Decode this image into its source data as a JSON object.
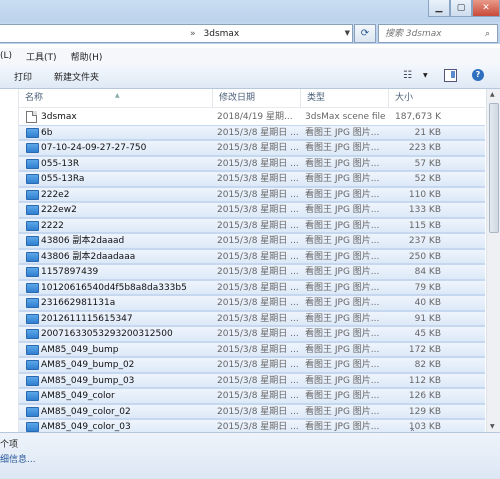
{
  "address": {
    "separator": "»",
    "path": "3dsmax",
    "search_placeholder": "搜索 3dsmax"
  },
  "menu": [
    "(L)",
    "工具(T)",
    "帮助(H)"
  ],
  "toolbar": {
    "print_label": "打印",
    "new_folder_label": "新建文件夹"
  },
  "columns": {
    "name": "名称",
    "date": "修改日期",
    "type": "类型",
    "size": "大小"
  },
  "files": [
    {
      "name": "3dsmax",
      "date": "2018/4/19 星期...",
      "type": "3dsMax scene file",
      "size": "187,673 KB",
      "icon": "max",
      "selected": false
    },
    {
      "name": "6b",
      "date": "2015/3/8 星期日 ...",
      "type": "看图王 JPG 图片...",
      "size": "21 KB",
      "icon": "jpg",
      "selected": true
    },
    {
      "name": "07-10-24-09-27-27-750",
      "date": "2015/3/8 星期日 ...",
      "type": "看图王 JPG 图片...",
      "size": "223 KB",
      "icon": "jpg",
      "selected": true
    },
    {
      "name": "055-13R",
      "date": "2015/3/8 星期日 ...",
      "type": "看图王 JPG 图片...",
      "size": "57 KB",
      "icon": "jpg",
      "selected": true
    },
    {
      "name": "055-13Ra",
      "date": "2015/3/8 星期日 ...",
      "type": "看图王 JPG 图片...",
      "size": "52 KB",
      "icon": "jpg",
      "selected": true
    },
    {
      "name": "222e2",
      "date": "2015/3/8 星期日 ...",
      "type": "看图王 JPG 图片...",
      "size": "110 KB",
      "icon": "jpg",
      "selected": true
    },
    {
      "name": "222ew2",
      "date": "2015/3/8 星期日 ...",
      "type": "看图王 JPG 图片...",
      "size": "133 KB",
      "icon": "jpg",
      "selected": true
    },
    {
      "name": "2222",
      "date": "2015/3/8 星期日 ...",
      "type": "看图王 JPG 图片...",
      "size": "115 KB",
      "icon": "jpg",
      "selected": true
    },
    {
      "name": "43806 副本2daaad",
      "date": "2015/3/8 星期日 ...",
      "type": "看图王 JPG 图片...",
      "size": "237 KB",
      "icon": "jpg",
      "selected": true
    },
    {
      "name": "43806 副本2daadaaa",
      "date": "2015/3/8 星期日 ...",
      "type": "看图王 JPG 图片...",
      "size": "250 KB",
      "icon": "jpg",
      "selected": true
    },
    {
      "name": "1157897439",
      "date": "2015/3/8 星期日 ...",
      "type": "看图王 JPG 图片...",
      "size": "84 KB",
      "icon": "jpg",
      "selected": true
    },
    {
      "name": "10120616540d4f5b8a8da333b5",
      "date": "2015/3/8 星期日 ...",
      "type": "看图王 JPG 图片...",
      "size": "79 KB",
      "icon": "jpg",
      "selected": true
    },
    {
      "name": "231662981131a",
      "date": "2015/3/8 星期日 ...",
      "type": "看图王 JPG 图片...",
      "size": "40 KB",
      "icon": "jpg",
      "selected": true
    },
    {
      "name": "2012611115615347",
      "date": "2015/3/8 星期日 ...",
      "type": "看图王 JPG 图片...",
      "size": "91 KB",
      "icon": "jpg",
      "selected": true
    },
    {
      "name": "20071633053293200312500",
      "date": "2015/3/8 星期日 ...",
      "type": "看图王 JPG 图片...",
      "size": "45 KB",
      "icon": "jpg",
      "selected": true
    },
    {
      "name": "AM85_049_bump",
      "date": "2015/3/8 星期日 ...",
      "type": "看图王 JPG 图片...",
      "size": "172 KB",
      "icon": "jpg",
      "selected": true
    },
    {
      "name": "AM85_049_bump_02",
      "date": "2015/3/8 星期日 ...",
      "type": "看图王 JPG 图片...",
      "size": "82 KB",
      "icon": "jpg",
      "selected": true
    },
    {
      "name": "AM85_049_bump_03",
      "date": "2015/3/8 星期日 ...",
      "type": "看图王 JPG 图片...",
      "size": "112 KB",
      "icon": "jpg",
      "selected": true
    },
    {
      "name": "AM85_049_color",
      "date": "2015/3/8 星期日 ...",
      "type": "看图王 JPG 图片...",
      "size": "126 KB",
      "icon": "jpg",
      "selected": true
    },
    {
      "name": "AM85_049_color_02",
      "date": "2015/3/8 星期日 ...",
      "type": "看图王 JPG 图片...",
      "size": "129 KB",
      "icon": "jpg",
      "selected": true
    },
    {
      "name": "AM85_049_color_03",
      "date": "2015/3/8 星期日 ...",
      "type": "看图王 JPG 图片...",
      "size": "103 KB",
      "icon": "jpg",
      "selected": true
    }
  ],
  "details": {
    "count_text": "个项",
    "more_text": "细信息..."
  },
  "colors": {
    "selection": "#dde9f8",
    "jpg_icon": "#2f7fd0",
    "chrome": "#c4d9f0"
  }
}
